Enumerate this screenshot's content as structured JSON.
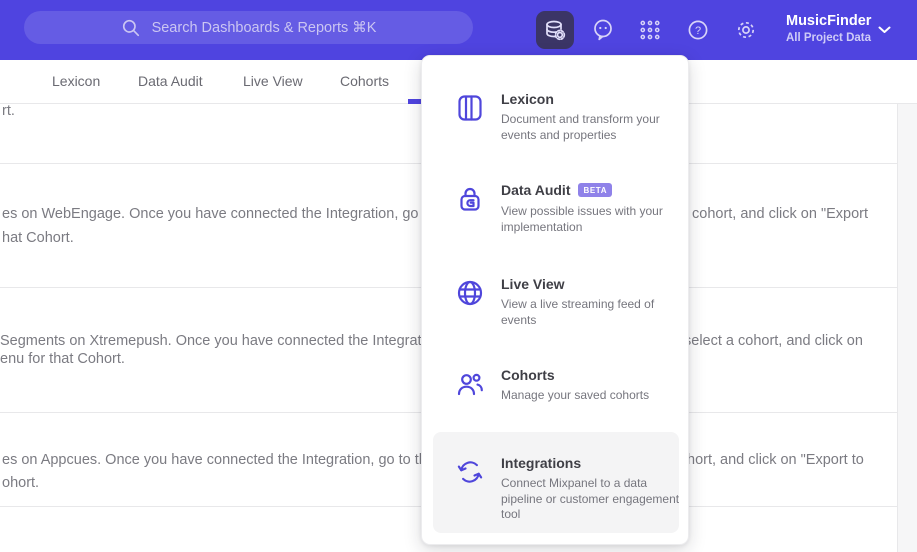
{
  "topbar": {
    "search_placeholder": "Search Dashboards & Reports ⌘K",
    "project_name": "MusicFinder",
    "project_scope": "All Project Data"
  },
  "nav": {
    "tabs": [
      {
        "label": "Lexicon"
      },
      {
        "label": "Data Audit"
      },
      {
        "label": "Live View"
      },
      {
        "label": "Cohorts"
      }
    ]
  },
  "menu": {
    "items": [
      {
        "title": "Lexicon",
        "description": "Document and transform your events and properties"
      },
      {
        "title": "Data Audit",
        "badge": "BETA",
        "description": "View possible issues with your implementation"
      },
      {
        "title": "Live View",
        "description": "View a live streaming feed of events"
      },
      {
        "title": "Cohorts",
        "description": "Manage your saved cohorts"
      },
      {
        "title": "Integrations",
        "description": "Connect Mixpanel to a data pipeline or customer engagement tool"
      }
    ]
  },
  "content": {
    "rows": [
      {
        "l1": "rt."
      },
      {
        "l1": "es on WebEngage. Once you have connected the Integration, go to the",
        "l2": "hat Cohort.",
        "r1": "cohort, and click on \"Export"
      },
      {
        "l1": "Segments on Xtremepush. Once you have connected the Integration, ",
        "l2": "enu for that Cohort.",
        "r1": "select a cohort, and click on"
      },
      {
        "l1": "es on Appcues. Once you have connected the Integration, go to the M",
        "l2": "ohort.",
        "r1": "hort, and click on \"Export to"
      }
    ]
  },
  "colors": {
    "topbar_bg": "#4F44E0",
    "accent": "#4F44E0",
    "active_icon_bg": "#3B3566",
    "menu_icon": "#4F46DB",
    "beta_badge_bg": "#8F82E9",
    "menu_highlight_bg": "#F4F4F5",
    "title_text": "#3F3F46",
    "muted_text": "#76767E",
    "divider": "#E8E8EA"
  }
}
